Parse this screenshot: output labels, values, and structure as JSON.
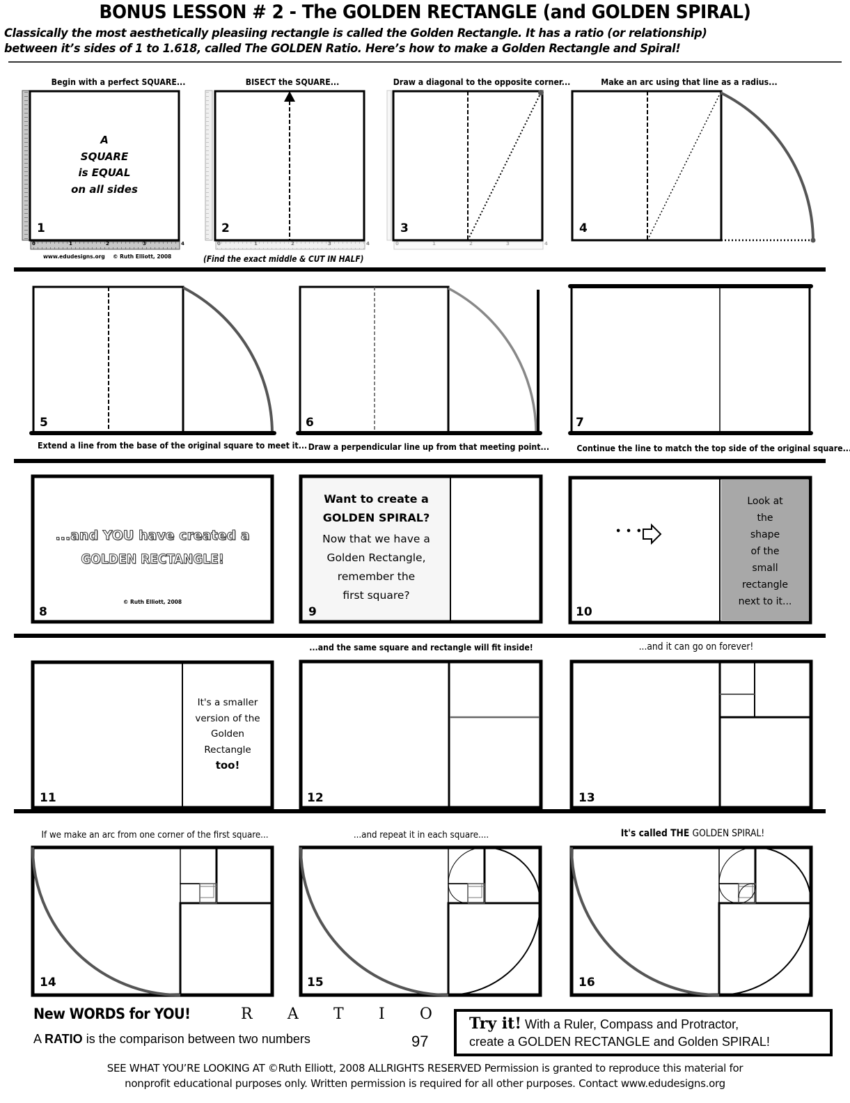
{
  "header": {
    "title": "BONUS LESSON # 2 - The GOLDEN RECTANGLE (and GOLDEN SPIRAL)",
    "intro_line1": "Classically the most aesthetically pleasiing rectangle is called the Golden Rectangle. It has a ratio (or relationship)",
    "intro_line2": "between it’s sides of 1 to 1.618, called The GOLDEN Ratio. Here’s how to make a Golden Rectangle and Spiral!"
  },
  "steps": [
    {
      "number": "1",
      "caption": "Begin with a perfect SQUARE...",
      "body": [
        "A",
        "SQUARE",
        "is EQUAL",
        "on all sides"
      ],
      "credit_site": "www.edudesigns.org",
      "credit_author": "© Ruth Elliott, 2008",
      "ruler_ticks": [
        "0",
        "1",
        "2",
        "3",
        "4"
      ]
    },
    {
      "number": "2",
      "caption": "BISECT the SQUARE...",
      "subcaption": "(Find the exact middle & CUT IN HALF)",
      "ruler_ticks": [
        "0",
        "1",
        "2",
        "3",
        "4"
      ]
    },
    {
      "number": "3",
      "caption": "Draw a diagonal to the opposite corner...",
      "ruler_ticks": [
        "0",
        "1",
        "2",
        "3",
        "4"
      ]
    },
    {
      "number": "4",
      "caption": "Make an arc using that line as a radius..."
    },
    {
      "number": "5",
      "caption": "Extend a line from the base of the original square to meet it..."
    },
    {
      "number": "6",
      "caption": "Draw a perpendicular line up from that meeting point..."
    },
    {
      "number": "7",
      "caption": "Continue the line to match the top side of the original square..."
    },
    {
      "number": "8",
      "line1": "...and YOU have created a",
      "line2": "GOLDEN RECTANGLE!",
      "credit": "© Ruth Elliott, 2008"
    },
    {
      "number": "9",
      "heading": [
        "Want to create a",
        "GOLDEN SPIRAL?"
      ],
      "body": [
        "Now that we have a",
        "Golden Rectangle,",
        "remember the",
        "first square?"
      ]
    },
    {
      "number": "10",
      "arrow_text": "• • •",
      "body": [
        "Look at",
        "the",
        "shape",
        "of the",
        "small",
        "rectangle",
        "next to it..."
      ]
    },
    {
      "number": "11",
      "body": [
        "It's a smaller",
        "version of the",
        "Golden",
        "Rectangle",
        "too!"
      ]
    },
    {
      "number": "12",
      "caption": "...and the same square and rectangle will fit inside!"
    },
    {
      "number": "13",
      "caption": "...and it can go on forever!"
    },
    {
      "number": "14",
      "caption": "If we make an arc from one corner of the first square..."
    },
    {
      "number": "15",
      "caption": "...and repeat it in each square...."
    },
    {
      "number": "16",
      "caption_bold": "It's called THE ",
      "caption_light": "GOLDEN SPIRAL!"
    }
  ],
  "vocab": {
    "heading": "New WORDS for YOU!",
    "letters": [
      "R",
      "A",
      "T",
      "I",
      "O"
    ],
    "definition_prefix": "A ",
    "definition_term": "RATIO",
    "definition_rest": " is the comparison between two numbers",
    "page_number": "97"
  },
  "try_it": {
    "label": "Try it!",
    "line1": "With a Ruler, Compass and Protractor,",
    "line2": "create a GOLDEN RECTANGLE and Golden SPIRAL!"
  },
  "footer": {
    "line1": "SEE WHAT YOU’RE LOOKING AT ©Ruth Elliott, 2008   ALLRIGHTS RESERVED  Permission is granted to reproduce this material for",
    "line2": "nonprofit educational purposes only. Written permission is required for all other purposes. Contact www.edudesigns.org"
  },
  "colors": {
    "ink": "#000000",
    "arc": "#555555",
    "shade": "#a8a8a8",
    "ruler": "#c8c8c8"
  }
}
